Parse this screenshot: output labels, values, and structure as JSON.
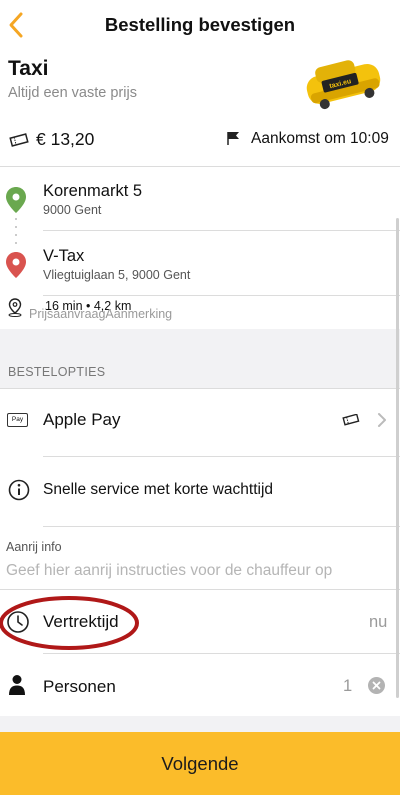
{
  "header": {
    "title": "Bestelling bevestigen",
    "back_icon": "chevron-left-icon",
    "accent": "#fbbc2a"
  },
  "service": {
    "name": "Taxi",
    "subtitle": "Altijd een vaste prijs",
    "car_logo_text": "taxi.eu",
    "price": "€ 13,20",
    "arrival": "Aankomst om 10:09"
  },
  "route": {
    "pickup": {
      "name": "Korenmarkt 5",
      "address": "9000 Gent",
      "pin_color": "#6aa84f"
    },
    "dropoff": {
      "name": "V-Tax",
      "address": "Vliegtuiglaan 5, 9000 Gent",
      "pin_color": "#d9534f"
    },
    "meta": "16 min  •  4,2 km",
    "overlay_text": "PrijsaanvraagAanmerking"
  },
  "options": {
    "section_label": "BESTELOPTIES",
    "payment": {
      "label": "Apple Pay",
      "icon_text": "Pay"
    },
    "info": {
      "label": "Snelle service met korte wachttijd"
    },
    "driver_info": {
      "label": "Aanrij info",
      "placeholder": "Geef hier aanrij instructies voor de chauffeur op",
      "value": ""
    },
    "departure": {
      "label": "Vertrektijd",
      "value": "nu"
    },
    "persons": {
      "label": "Personen",
      "value": "1"
    }
  },
  "cta": {
    "label": "Volgende"
  },
  "annotation_color": "#b01818"
}
